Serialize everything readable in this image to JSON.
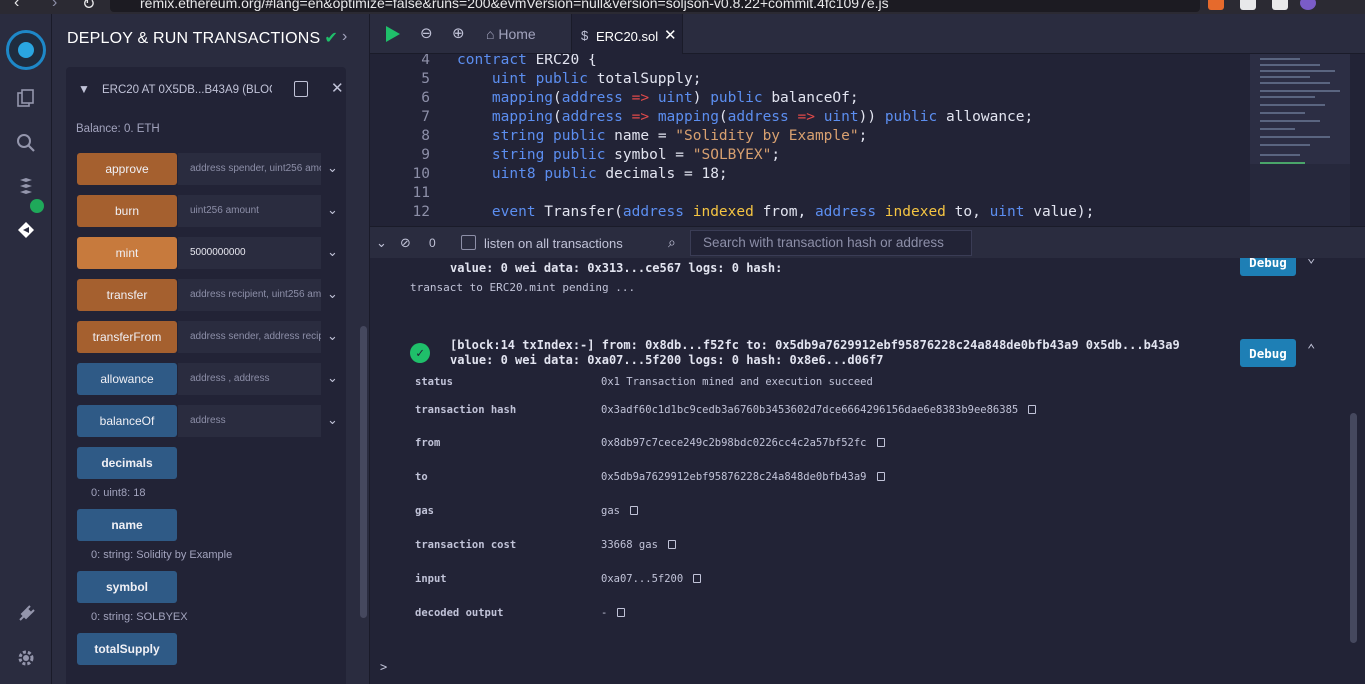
{
  "browser": {
    "url": "remix.ethereum.org/#lang=en&optimize=false&runs=200&evmVersion=null&version=soljson-v0.8.22+commit.4fc1097e.js"
  },
  "panel": {
    "title": "DEPLOY & RUN TRANSACTIONS",
    "contract_name": "ERC20 AT 0X5DB...B43A9 (BLOCKCHAIN)",
    "balance": "Balance: 0. ETH",
    "functions": [
      {
        "label": "approve",
        "kind": "tx",
        "placeholder": "address spender, uint256 amount",
        "value": ""
      },
      {
        "label": "burn",
        "kind": "tx",
        "placeholder": "uint256 amount",
        "value": ""
      },
      {
        "label": "mint",
        "kind": "payable",
        "placeholder": "",
        "value": "5000000000"
      },
      {
        "label": "transfer",
        "kind": "tx",
        "placeholder": "address recipient, uint256 amount",
        "value": ""
      },
      {
        "label": "transferFrom",
        "kind": "tx",
        "placeholder": "address sender, address recipient, uint256 amount",
        "value": ""
      },
      {
        "label": "allowance",
        "kind": "call",
        "placeholder": "address , address",
        "value": ""
      },
      {
        "label": "balanceOf",
        "kind": "call",
        "placeholder": "address",
        "value": ""
      }
    ],
    "getters": [
      {
        "label": "decimals",
        "result": "0: uint8: 18"
      },
      {
        "label": "name",
        "result": "0: string: Solidity by Example"
      },
      {
        "label": "symbol",
        "result": "0: string: SOLBYEX"
      },
      {
        "label": "totalSupply",
        "result": ""
      }
    ]
  },
  "tabs": {
    "home": "Home",
    "file": "ERC20.sol"
  },
  "code": [
    {
      "n": "4",
      "text": "contract ERC20 {"
    },
    {
      "n": "5",
      "text": "    uint public totalSupply;"
    },
    {
      "n": "6",
      "text": "    mapping(address => uint) public balanceOf;"
    },
    {
      "n": "7",
      "text": "    mapping(address => mapping(address => uint)) public allowance;"
    },
    {
      "n": "8",
      "text": "    string public name = \"Solidity by Example\";"
    },
    {
      "n": "9",
      "text": "    string public symbol = \"SOLBYEX\";"
    },
    {
      "n": "10",
      "text": "    uint8 public decimals = 18;"
    },
    {
      "n": "11",
      "text": ""
    },
    {
      "n": "12",
      "text": "    event Transfer(address indexed from, address indexed to, uint value);"
    }
  ],
  "terminal": {
    "pending_count": "0",
    "listen_label": "listen on all transactions",
    "search_placeholder": "Search with transaction hash or address",
    "prev_tx_line": "value: 0 wei data: 0x313...ce567 logs: 0 hash:",
    "pending_msg": "transact to ERC20.mint pending ...",
    "tx_header": "[block:14 txIndex:-] from: 0x8db...f52fc to: 0x5db9a7629912ebf95876228c24a848de0bfb43a9 0x5db...b43a9",
    "tx_sub": "value: 0 wei data: 0xa07...5f200 logs: 0 hash: 0x8e6...d06f7",
    "debug_label": "Debug",
    "prompt": ">",
    "details": [
      {
        "key": "status",
        "value": "0x1 Transaction mined and execution succeed",
        "copy": false
      },
      {
        "key": "transaction hash",
        "value": "0x3adf60c1d1bc9cedb3a6760b3453602d7dce6664296156dae6e8383b9ee86385",
        "copy": true
      },
      {
        "key": "from",
        "value": "0x8db97c7cece249c2b98bdc0226cc4c2a57bf52fc",
        "copy": true
      },
      {
        "key": "to",
        "value": "0x5db9a7629912ebf95876228c24a848de0bfb43a9",
        "copy": true
      },
      {
        "key": "gas",
        "value": " gas",
        "copy": true
      },
      {
        "key": "transaction cost",
        "value": "33668 gas",
        "copy": true
      },
      {
        "key": "input",
        "value": "0xa07...5f200",
        "copy": true
      },
      {
        "key": "decoded output",
        "value": " -",
        "copy": true
      }
    ]
  },
  "colors": {
    "tx_button": "#a5602f",
    "payable_button": "#c77a3d",
    "call_button": "#2f5a86",
    "success": "#1fbf6a",
    "debug": "#1e7fb5"
  }
}
